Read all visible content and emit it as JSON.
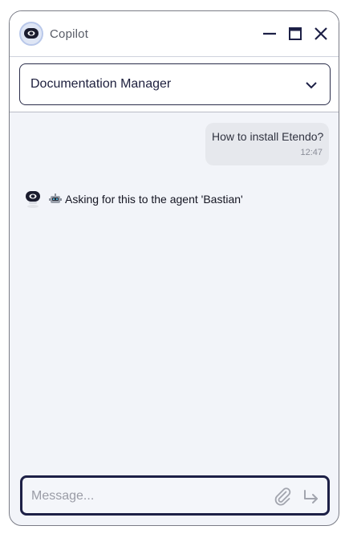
{
  "app": {
    "title": "Copilot"
  },
  "window_controls": {
    "minimize_icon": "minimize-icon",
    "maximize_icon": "maximize-icon",
    "close_icon": "close-icon"
  },
  "assistant_selector": {
    "selected": "Documentation Manager",
    "icon": "chevron-down-icon"
  },
  "messages": [
    {
      "role": "user",
      "text": "How to install Etendo?",
      "time": "12:47"
    },
    {
      "role": "bot",
      "text": "Asking for this to the agent 'Bastian'",
      "prefix_icon": "robot-icon"
    }
  ],
  "composer": {
    "placeholder": "Message...",
    "attach_icon": "paperclip-icon",
    "send_icon": "send-arrow-icon"
  },
  "colors": {
    "accent": "#1d2046",
    "background": "#f2f4f9",
    "user_bubble": "#e6e8ed"
  }
}
